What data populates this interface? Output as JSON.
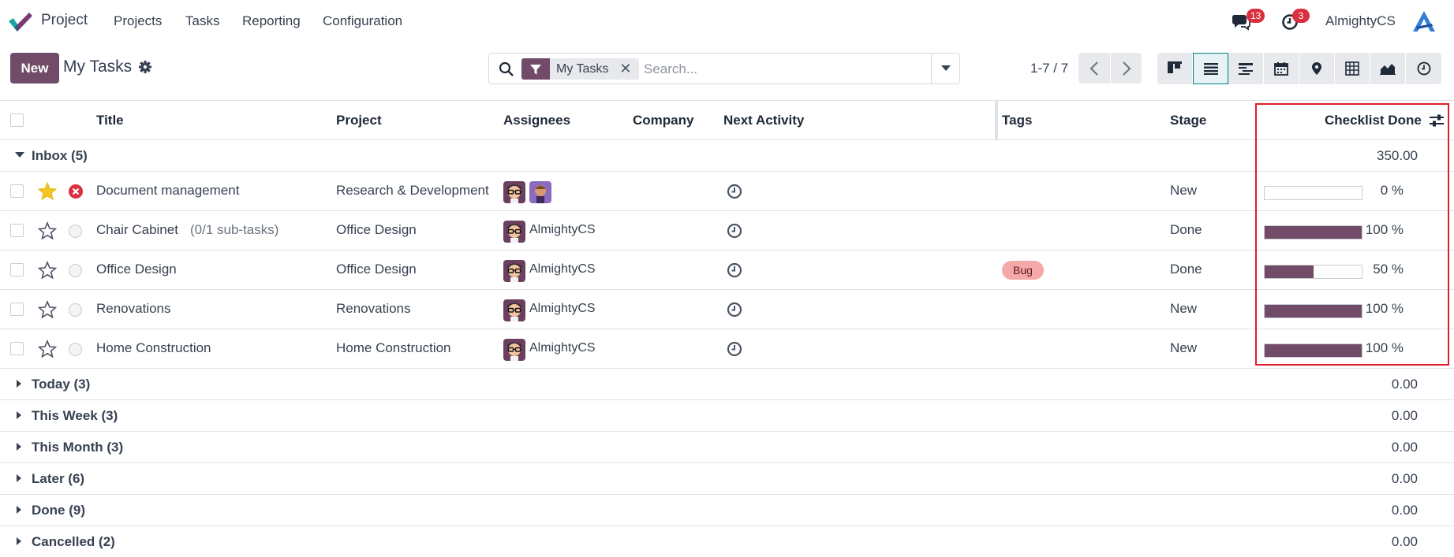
{
  "topnav": {
    "app_name": "Project",
    "menu": [
      "Projects",
      "Tasks",
      "Reporting",
      "Configuration"
    ],
    "messages_badge": "13",
    "activities_badge": "3",
    "user_name": "AlmightyCS"
  },
  "control_panel": {
    "new_label": "New",
    "title": "My Tasks",
    "facet_label": "My Tasks",
    "facet_remove": "✕",
    "search_placeholder": "Search...",
    "pager": "1-7 / 7",
    "views": [
      "kanban-icon",
      "list-icon",
      "gantt-icon",
      "calendar-icon",
      "map-pin-icon",
      "pivot-icon",
      "graph-icon",
      "activity-icon"
    ]
  },
  "table": {
    "headers": {
      "title": "Title",
      "project": "Project",
      "assignees": "Assignees",
      "company": "Company",
      "next_activity": "Next Activity",
      "tags": "Tags",
      "stage": "Stage",
      "checklist": "Checklist Done"
    },
    "open_group": {
      "label": "Inbox (5)",
      "total": "350.00"
    },
    "rows": [
      {
        "title": "Document management",
        "subtasks": "",
        "project": "Research & Development",
        "assignee": "",
        "tag": "",
        "stage": "New",
        "progress": 0,
        "progress_text": "0 %",
        "starred": true,
        "state": "blocked"
      },
      {
        "title": "Chair Cabinet",
        "subtasks": "(0/1 sub-tasks)",
        "project": "Office Design",
        "assignee": "AlmightyCS",
        "tag": "",
        "stage": "Done",
        "progress": 100,
        "progress_text": "100 %",
        "starred": false,
        "state": "normal"
      },
      {
        "title": "Office Design",
        "subtasks": "",
        "project": "Office Design",
        "assignee": "AlmightyCS",
        "tag": "Bug",
        "stage": "Done",
        "progress": 50,
        "progress_text": "50 %",
        "starred": false,
        "state": "normal"
      },
      {
        "title": "Renovations",
        "subtasks": "",
        "project": "Renovations",
        "assignee": "AlmightyCS",
        "tag": "",
        "stage": "New",
        "progress": 100,
        "progress_text": "100 %",
        "starred": false,
        "state": "normal"
      },
      {
        "title": "Home Construction",
        "subtasks": "",
        "project": "Home Construction",
        "assignee": "AlmightyCS",
        "tag": "",
        "stage": "New",
        "progress": 100,
        "progress_text": "100 %",
        "starred": false,
        "state": "normal"
      }
    ],
    "closed_groups": [
      {
        "label": "Today (3)",
        "total": "0.00"
      },
      {
        "label": "This Week (3)",
        "total": "0.00"
      },
      {
        "label": "This Month (3)",
        "total": "0.00"
      },
      {
        "label": "Later (6)",
        "total": "0.00"
      },
      {
        "label": "Done (9)",
        "total": "0.00"
      },
      {
        "label": "Cancelled (2)",
        "total": "0.00"
      }
    ]
  },
  "colors": {
    "brand": "#714b67",
    "badge": "#d9303e",
    "highlight": "#e11d2b",
    "tag_bug": "#f4a8a8"
  }
}
